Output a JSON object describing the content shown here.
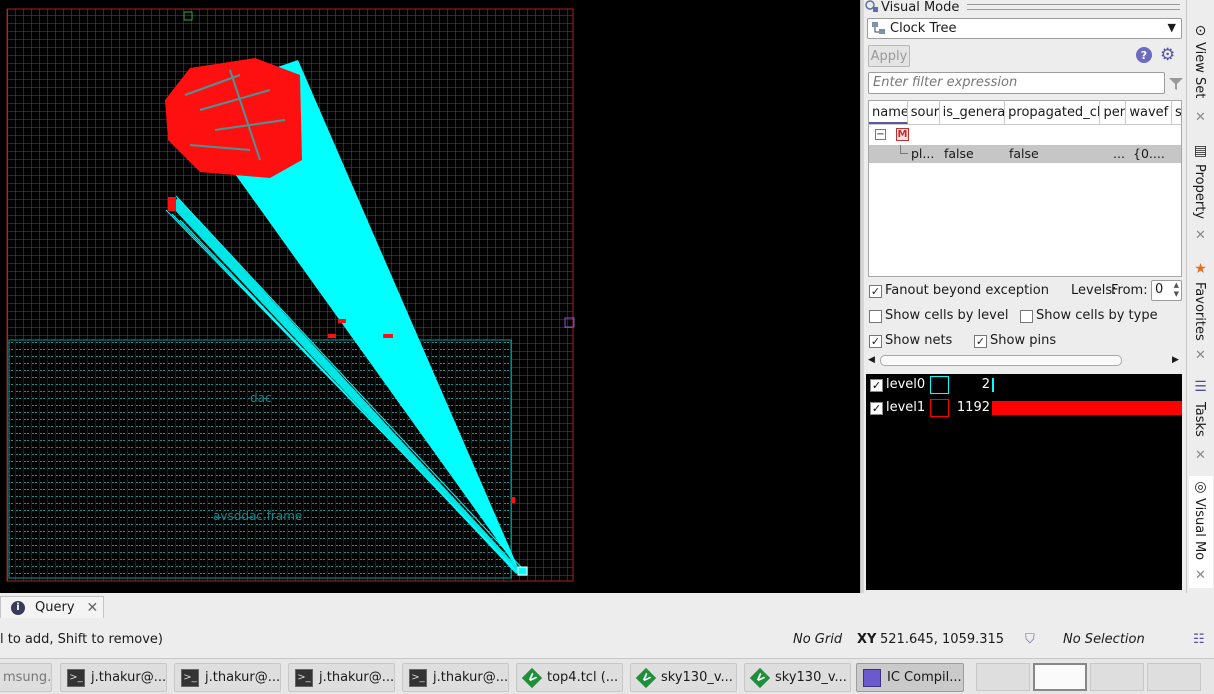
{
  "layout": {
    "labels": {
      "dac": "dac",
      "avsddac": "avsddac.frame"
    },
    "colors": {
      "grid": "#cc2222",
      "net": "#00ffff",
      "cells": "#ff1010",
      "frame": "#00a0a0"
    }
  },
  "panel": {
    "title": "Visual Mode",
    "mode_select": "Clock Tree",
    "apply_label": "Apply",
    "help_icon": "help-icon",
    "settings_icon": "gear-icon",
    "filter_placeholder": "Enter filter expression",
    "tree": {
      "columns": [
        "name",
        "sour",
        "is_genera",
        "propagated_cl",
        "per",
        "wavef",
        "s"
      ],
      "root_badge": "M",
      "row": {
        "name": "pl...",
        "is_generated": "false",
        "propagated": "false",
        "per": "...",
        "wave": "{0...."
      }
    },
    "options": {
      "fanout_label": "Fanout beyond exception",
      "fanout_checked": true,
      "levels_label": "Levels:",
      "from_label": "From:",
      "from_value": "0",
      "cells_by_level_label": "Show cells by level",
      "cells_by_level_checked": false,
      "cells_by_type_label": "Show cells by type",
      "cells_by_type_checked": false,
      "nets_label": "Show nets",
      "nets_checked": true,
      "pins_label": "Show pins",
      "pins_checked": true
    },
    "levels": [
      {
        "name": "level0",
        "count": "2",
        "color": "#00ffff",
        "fraction": 0.0017
      },
      {
        "name": "level1",
        "count": "1192",
        "color": "#ff0000",
        "fraction": 1.0
      }
    ]
  },
  "side_tabs": [
    {
      "label": "View Set",
      "icon": "view-set-icon"
    },
    {
      "label": "Property",
      "icon": "property-icon"
    },
    {
      "label": "Favorites",
      "icon": "star-icon"
    },
    {
      "label": "Tasks",
      "icon": "tasks-icon"
    },
    {
      "label": "Visual Mo",
      "icon": "visual-mode-icon"
    }
  ],
  "bottom": {
    "query_tab": "Query",
    "status_hint": "l to add, Shift to remove)",
    "grid": "No Grid",
    "xy_label": "XY",
    "xy_value": "521.645, 1059.315",
    "selection": "No Selection"
  },
  "taskbar": {
    "items": [
      {
        "label": "msung...",
        "icon": ""
      },
      {
        "label": "j.thakur@...",
        "icon": "terminal-icon"
      },
      {
        "label": "j.thakur@...",
        "icon": "terminal-icon"
      },
      {
        "label": "j.thakur@...",
        "icon": "terminal-icon"
      },
      {
        "label": "j.thakur@...",
        "icon": "terminal-icon"
      },
      {
        "label": "top4.tcl (...",
        "icon": "vim-icon"
      },
      {
        "label": "sky130_v...",
        "icon": "vim-icon"
      },
      {
        "label": "sky130_v...",
        "icon": "vim-icon"
      },
      {
        "label": "IC Compil...",
        "icon": "ic-compiler-icon"
      }
    ]
  }
}
